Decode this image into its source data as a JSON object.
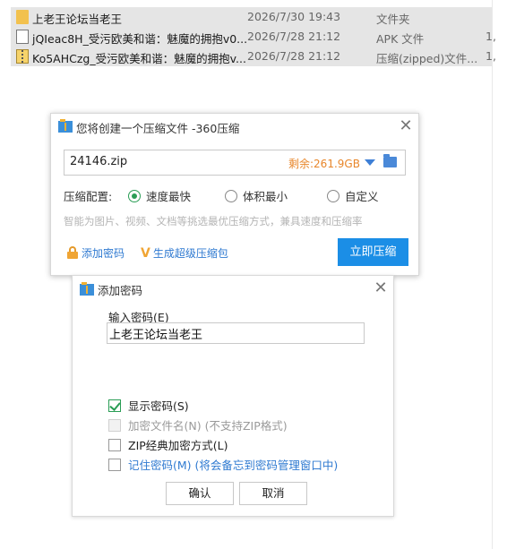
{
  "explorer": {
    "files": [
      {
        "icon": "folder-icon",
        "name": "上老王论坛当老王",
        "date": "2026/7/30 19:43",
        "type": "文件夹",
        "size": ""
      },
      {
        "icon": "file-icon",
        "name": "jQIeac8H_受污欧美和谐：魅魔的拥抱v0...",
        "date": "2026/7/28 21:12",
        "type": "APK 文件",
        "size": "1,"
      },
      {
        "icon": "zip-icon",
        "name": "Ko5AHCzg_受污欧美和谐：魅魔的拥抱v...",
        "date": "2026/7/28 21:12",
        "type": "压缩(zipped)文件...",
        "size": "1,"
      }
    ]
  },
  "compress_dialog": {
    "title": "您将创建一个压缩文件 -360压缩",
    "close_symbol": "✕",
    "filename": "24146.zip",
    "free_space": "剩余:261.9GB",
    "config_label": "压缩配置:",
    "options": [
      "速度最快",
      "体积最小",
      "自定义"
    ],
    "selected_option": "速度最快",
    "hint": "智能为图片、视频、文档等挑选最优压缩方式，兼具速度和压缩率",
    "add_password_link": "添加密码",
    "super_zip_link": "生成超级压缩包",
    "compress_button": "立即压缩"
  },
  "password_dialog": {
    "title": "添加密码",
    "close_symbol": "✕",
    "input_label": "输入密码(E)",
    "password_value": "上老王论坛当老王",
    "show_password": {
      "label": "显示密码(S)",
      "checked": true
    },
    "encrypt_filenames": {
      "label": "加密文件名(N) (不支持ZIP格式)",
      "checked": false,
      "disabled": true
    },
    "zip_classic": {
      "label": "ZIP经典加密方式(L)",
      "checked": false
    },
    "remember_password": {
      "label": "记住密码(M) (将会备忘到密码管理窗口中)",
      "checked": false
    },
    "ok_button": "确认",
    "cancel_button": "取消"
  },
  "colors": {
    "accent_blue": "#1b8ee6",
    "radio_green": "#2a9d55",
    "free_space_orange": "#e8862a",
    "link_blue": "#2f7ad1"
  }
}
